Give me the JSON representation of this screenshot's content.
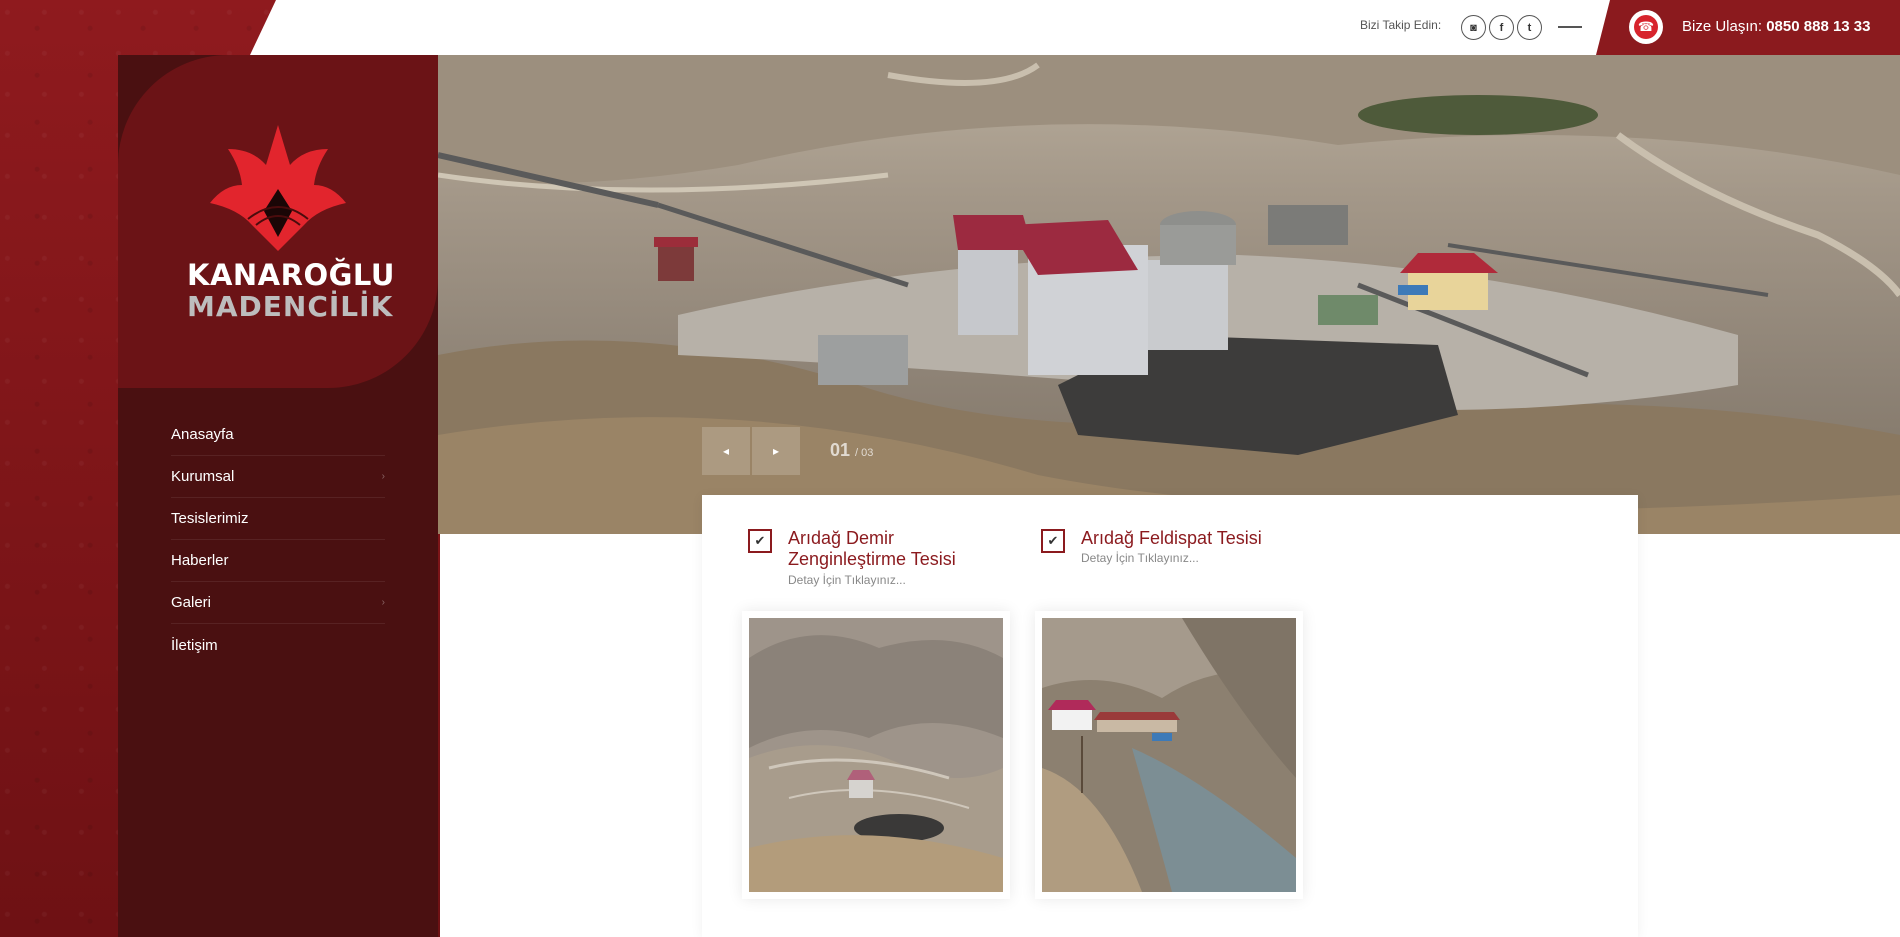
{
  "header": {
    "follow_label": "Bizi Takip Edin:",
    "social": [
      {
        "name": "instagram-icon",
        "glyph": "◙"
      },
      {
        "name": "facebook-icon",
        "glyph": "f"
      },
      {
        "name": "twitter-icon",
        "glyph": "t"
      }
    ],
    "contact_label": "Bize Ulaşın:",
    "contact_phone": "0850 888 13 33"
  },
  "brand": {
    "line1": "KANAROĞLU",
    "line2": "MADENCİLİK"
  },
  "menu": [
    {
      "label": "Anasayfa",
      "has_submenu": false
    },
    {
      "label": "Kurumsal",
      "has_submenu": true
    },
    {
      "label": "Tesislerimiz",
      "has_submenu": false
    },
    {
      "label": "Haberler",
      "has_submenu": false
    },
    {
      "label": "Galeri",
      "has_submenu": true
    },
    {
      "label": "İletişim",
      "has_submenu": false
    }
  ],
  "slider": {
    "prev_glyph": "◂",
    "next_glyph": "▸",
    "current": "01",
    "total": "/ 03"
  },
  "facilities": [
    {
      "title_line1": "Arıdağ Demir",
      "title_line2": "Zenginleştirme Tesisi",
      "subtitle": "Detay İçin Tıklayınız..."
    },
    {
      "title_line1": "Arıdağ Feldispat Tesisi",
      "title_line2": "",
      "subtitle": "Detay İçin Tıklayınız..."
    }
  ],
  "check_glyph": "✔",
  "colors": {
    "brand_red": "#8b1a1e",
    "dark_sidebar": "#4a1011",
    "logo_red": "#e2252d"
  }
}
